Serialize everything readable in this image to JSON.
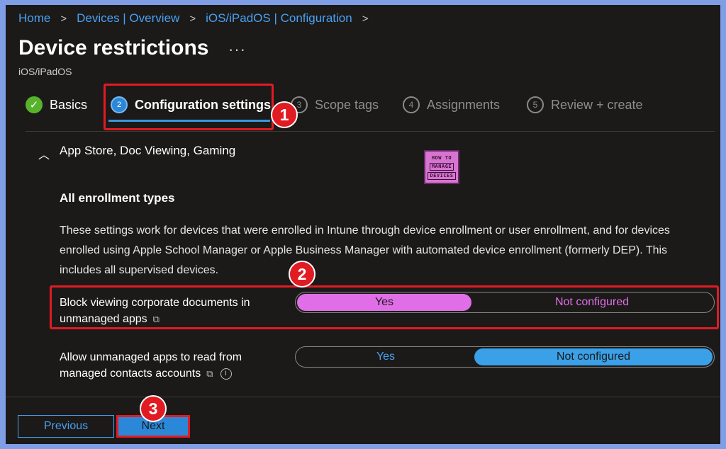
{
  "breadcrumb": {
    "items": [
      "Home",
      "Devices | Overview",
      "iOS/iPadOS | Configuration"
    ],
    "separator": ">"
  },
  "page": {
    "title": "Device restrictions",
    "more": "···",
    "subtitle": "iOS/iPadOS"
  },
  "tabs": [
    {
      "step": "✓",
      "label": "Basics",
      "state": "done"
    },
    {
      "step": "2",
      "label": "Configuration settings",
      "state": "active"
    },
    {
      "step": "3",
      "label": "Scope tags",
      "state": "todo"
    },
    {
      "step": "4",
      "label": "Assignments",
      "state": "todo"
    },
    {
      "step": "5",
      "label": "Review + create",
      "state": "todo"
    }
  ],
  "annotations": [
    "1",
    "2",
    "3"
  ],
  "section": {
    "chevron": "︿",
    "title": "App Store, Doc Viewing, Gaming"
  },
  "logo": {
    "line1": "HOW TO",
    "line2": "MANAGE",
    "line3": "DEVICES"
  },
  "enrollment": {
    "heading": "All enrollment types",
    "description": "These settings work for devices that were enrolled in Intune through device enrollment or user enrollment, and for devices enrolled using Apple School Manager or Apple Business Manager with automated device enrollment (formerly DEP). This includes all supervised devices."
  },
  "settings": [
    {
      "label": "Block viewing corporate documents in unmanaged apps",
      "options": [
        "Yes",
        "Not configured"
      ],
      "selected": "Yes"
    },
    {
      "label": "Allow unmanaged apps to read from managed contacts accounts",
      "options": [
        "Yes",
        "Not configured"
      ],
      "selected": "Not configured",
      "info_icon": "i"
    }
  ],
  "footer": {
    "previous_label": "Previous",
    "next_label": "Next"
  },
  "colors": {
    "accent": "#2b88d8",
    "link": "#4aa0f0",
    "annotation": "#e11b22",
    "toggle_selected_pink": "#e06ee6",
    "background": "#1b1a19"
  }
}
